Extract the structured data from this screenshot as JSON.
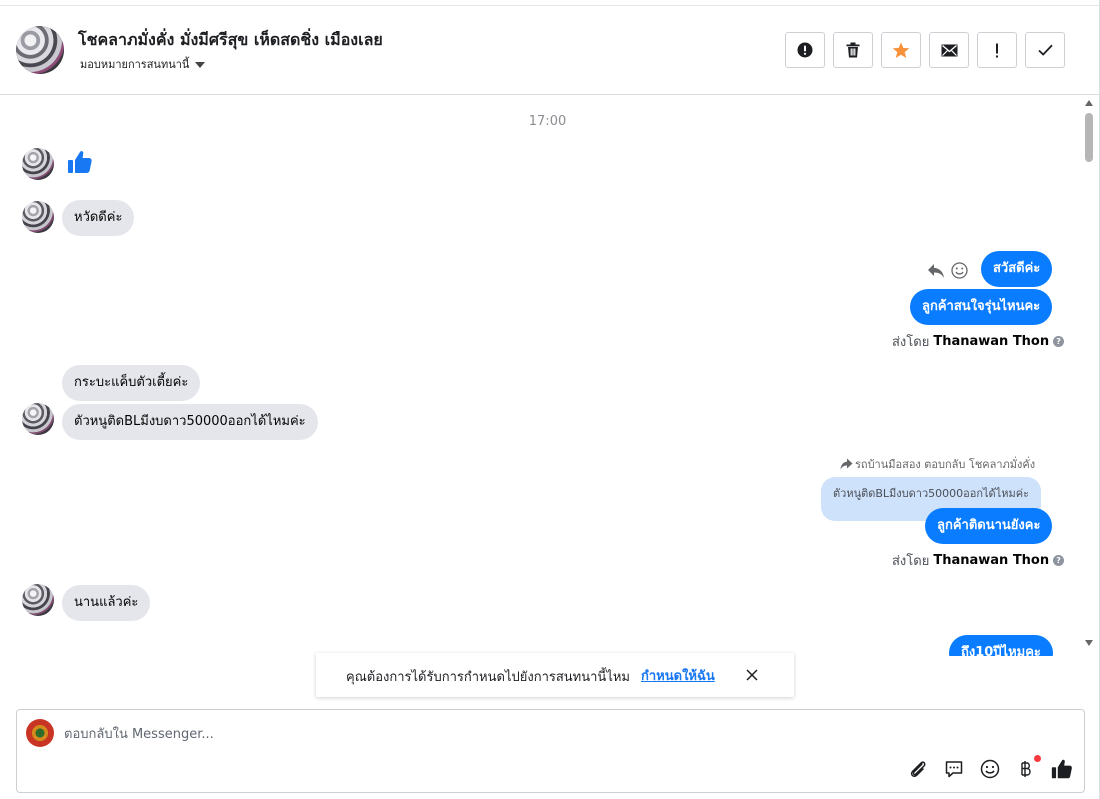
{
  "header": {
    "title": "โชคลาภมั่งคั่ง มั่งมีศรีสุข เห็ดสดชิ่ง เมืองเลย",
    "assign_label": "มอบหมายการสนทนานี้",
    "actions": [
      {
        "name": "report-button",
        "icon": "exclamation-circle-icon"
      },
      {
        "name": "delete-button",
        "icon": "trash-icon"
      },
      {
        "name": "star-button",
        "icon": "star-icon"
      },
      {
        "name": "mark-unread-button",
        "icon": "envelope-icon"
      },
      {
        "name": "priority-button",
        "icon": "exclamation-icon"
      },
      {
        "name": "mark-done-button",
        "icon": "checkmark-icon"
      }
    ]
  },
  "thread": {
    "timestamp": "17:00",
    "messages": {
      "in_greeting": "หวัดดีค่ะ",
      "out_hello": "สวัสดีค่ะ",
      "out_interest": "ลูกค้าสนใจรุ่นไหนคะ",
      "in_model_1": "กระบะแค็บตัวเตี้ยค่ะ",
      "in_model_2": "ตัวหนูติดBLมีงบดาว50000ออกได้ไหมค่ะ",
      "reply_info": "รถบ้านมือสอง ตอบกลับ โชคลาภมั่งคั่ง",
      "quoted": "ตัวหนูติดBLมีงบดาว50000ออกได้ไหมค่ะ",
      "out_blacklist": "ลูกค้าติดนานยังคะ",
      "in_long_ago": "นานแล้วค่ะ",
      "out_partial": "ถึง10ปีไหมคะ"
    },
    "sent_by_prefix": "ส่งโดย",
    "sent_by_name": "Thanawan Thon"
  },
  "notice": {
    "text": "คุณต้องการได้รับการกำหนดไปยังการสนทนานี้ไหม",
    "link": "กำหนดให้ฉัน"
  },
  "composer": {
    "placeholder": "ตอบกลับใน Messenger...",
    "tools": [
      "paperclip-icon",
      "saved-replies-icon",
      "emoji-icon",
      "baht-payment-icon",
      "like-icon"
    ]
  },
  "colors": {
    "accent": "#0a7cff",
    "incoming_bubble": "#e4e6eb",
    "quoted_bubble": "#cfe2fb",
    "star": "#f7923b",
    "like_blue": "#1877f2"
  }
}
